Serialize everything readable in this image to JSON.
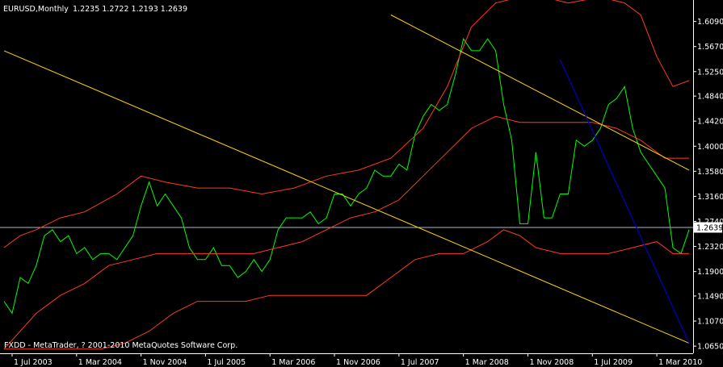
{
  "header": {
    "symbol_timeframe": "EURUSD,Monthly",
    "ohlc": "1.2235 1.2722 1.2193 1.2639"
  },
  "footer": {
    "copyright": "FXDD - MetaTrader, ? 2001-2010 MetaQuotes Software Corp."
  },
  "price_marker": {
    "label": "1.2639"
  },
  "colors": {
    "background": "#000000",
    "axis": "#ffffff",
    "price": "#00ff00",
    "bands": "#ff3b20",
    "channel": "#ffd700",
    "trendline_blue": "#0000c8",
    "price_line": "#b0b8c8"
  },
  "chart_data": {
    "type": "line",
    "title": "EURUSD,Monthly",
    "ylim": [
      1.053,
      1.645
    ],
    "y_ticks": [
      "1.6090",
      "1.5670",
      "1.5250",
      "1.4840",
      "1.4420",
      "1.4000",
      "1.3580",
      "1.3160",
      "1.2740",
      "1.2320",
      "1.1900",
      "1.1490",
      "1.1070",
      "1.0650"
    ],
    "x_ticks": [
      "1 Jul 2003",
      "1 Mar 2004",
      "1 Nov 2004",
      "1 Jul 2005",
      "1 Mar 2006",
      "1 Nov 2006",
      "1 Jul 2007",
      "1 Mar 2008",
      "1 Nov 2008",
      "1 Jul 2009",
      "1 Mar 2010"
    ],
    "x_start": "2003-06",
    "x_end": "2010-07",
    "series": [
      {
        "role": "price",
        "x": [
          "2003-06",
          "2003-07",
          "2003-08",
          "2003-09",
          "2003-10",
          "2003-11",
          "2003-12",
          "2004-01",
          "2004-02",
          "2004-03",
          "2004-04",
          "2004-05",
          "2004-06",
          "2004-07",
          "2004-08",
          "2004-09",
          "2004-10",
          "2004-11",
          "2004-12",
          "2005-01",
          "2005-02",
          "2005-03",
          "2005-04",
          "2005-05",
          "2005-06",
          "2005-07",
          "2005-08",
          "2005-09",
          "2005-10",
          "2005-11",
          "2005-12",
          "2006-01",
          "2006-02",
          "2006-03",
          "2006-04",
          "2006-05",
          "2006-06",
          "2006-07",
          "2006-08",
          "2006-09",
          "2006-10",
          "2006-11",
          "2006-12",
          "2007-01",
          "2007-02",
          "2007-03",
          "2007-04",
          "2007-05",
          "2007-06",
          "2007-07",
          "2007-08",
          "2007-09",
          "2007-10",
          "2007-11",
          "2007-12",
          "2008-01",
          "2008-02",
          "2008-03",
          "2008-04",
          "2008-05",
          "2008-06",
          "2008-07",
          "2008-08",
          "2008-09",
          "2008-10",
          "2008-11",
          "2008-12",
          "2009-01",
          "2009-02",
          "2009-03",
          "2009-04",
          "2009-05",
          "2009-06",
          "2009-07",
          "2009-08",
          "2009-09",
          "2009-10",
          "2009-11",
          "2009-12",
          "2010-01",
          "2010-02",
          "2010-03",
          "2010-04",
          "2010-05",
          "2010-06",
          "2010-07"
        ],
        "values": [
          1.14,
          1.12,
          1.18,
          1.17,
          1.2,
          1.25,
          1.26,
          1.24,
          1.25,
          1.22,
          1.23,
          1.21,
          1.22,
          1.22,
          1.21,
          1.23,
          1.25,
          1.3,
          1.34,
          1.3,
          1.32,
          1.3,
          1.28,
          1.23,
          1.21,
          1.21,
          1.23,
          1.2,
          1.2,
          1.18,
          1.19,
          1.21,
          1.19,
          1.21,
          1.26,
          1.28,
          1.28,
          1.28,
          1.29,
          1.27,
          1.28,
          1.32,
          1.32,
          1.3,
          1.32,
          1.33,
          1.36,
          1.35,
          1.35,
          1.37,
          1.36,
          1.42,
          1.45,
          1.47,
          1.46,
          1.47,
          1.52,
          1.58,
          1.56,
          1.56,
          1.58,
          1.56,
          1.47,
          1.41,
          1.27,
          1.27,
          1.39,
          1.28,
          1.28,
          1.32,
          1.32,
          1.41,
          1.4,
          1.41,
          1.43,
          1.47,
          1.48,
          1.5,
          1.43,
          1.39,
          1.37,
          1.35,
          1.33,
          1.23,
          1.22,
          1.26
        ]
      },
      {
        "role": "upper-band",
        "x": [
          "2003-06",
          "2003-08",
          "2003-10",
          "2004-01",
          "2004-04",
          "2004-08",
          "2004-11",
          "2005-02",
          "2005-06",
          "2005-10",
          "2006-02",
          "2006-06",
          "2006-10",
          "2007-02",
          "2007-06",
          "2007-10",
          "2008-01",
          "2008-04",
          "2008-07",
          "2008-10",
          "2009-01",
          "2009-04",
          "2009-08",
          "2009-11",
          "2010-01",
          "2010-03",
          "2010-05",
          "2010-07"
        ],
        "values": [
          1.23,
          1.25,
          1.26,
          1.28,
          1.29,
          1.32,
          1.35,
          1.34,
          1.33,
          1.33,
          1.32,
          1.33,
          1.35,
          1.36,
          1.38,
          1.43,
          1.5,
          1.6,
          1.64,
          1.65,
          1.65,
          1.64,
          1.65,
          1.64,
          1.62,
          1.55,
          1.5,
          1.51
        ]
      },
      {
        "role": "middle-band",
        "x": [
          "2003-06",
          "2003-08",
          "2003-10",
          "2004-01",
          "2004-04",
          "2004-07",
          "2004-10",
          "2005-01",
          "2005-04",
          "2005-07",
          "2005-10",
          "2006-01",
          "2006-04",
          "2006-07",
          "2006-10",
          "2007-01",
          "2007-04",
          "2007-07",
          "2007-10",
          "2008-01",
          "2008-04",
          "2008-07",
          "2008-10",
          "2009-01",
          "2009-04",
          "2009-07",
          "2009-10",
          "2010-01",
          "2010-04",
          "2010-07"
        ],
        "values": [
          1.06,
          1.09,
          1.12,
          1.15,
          1.17,
          1.2,
          1.21,
          1.22,
          1.22,
          1.22,
          1.22,
          1.22,
          1.23,
          1.24,
          1.26,
          1.28,
          1.29,
          1.31,
          1.35,
          1.39,
          1.43,
          1.45,
          1.44,
          1.44,
          1.44,
          1.44,
          1.43,
          1.41,
          1.38,
          1.38
        ]
      },
      {
        "role": "lower-band",
        "x": [
          "2003-06",
          "2003-09",
          "2003-12",
          "2004-03",
          "2004-06",
          "2004-09",
          "2004-12",
          "2005-03",
          "2005-06",
          "2005-09",
          "2005-12",
          "2006-03",
          "2006-06",
          "2006-09",
          "2006-12",
          "2007-03",
          "2007-06",
          "2007-09",
          "2007-12",
          "2008-03",
          "2008-06",
          "2008-08",
          "2008-10",
          "2008-12",
          "2009-03",
          "2009-06",
          "2009-09",
          "2009-12",
          "2010-03",
          "2010-05",
          "2010-07"
        ],
        "values": [
          1.06,
          1.06,
          1.06,
          1.06,
          1.06,
          1.07,
          1.09,
          1.12,
          1.14,
          1.14,
          1.14,
          1.15,
          1.15,
          1.15,
          1.15,
          1.15,
          1.18,
          1.21,
          1.22,
          1.22,
          1.24,
          1.26,
          1.25,
          1.23,
          1.22,
          1.22,
          1.22,
          1.23,
          1.24,
          1.22,
          1.22
        ]
      },
      {
        "role": "channel-lower",
        "x": [
          "2003-06",
          "2010-07"
        ],
        "values": [
          1.56,
          1.07
        ]
      },
      {
        "role": "channel-upper",
        "x": [
          "2007-06",
          "2010-07"
        ],
        "values": [
          1.62,
          1.36
        ]
      },
      {
        "role": "trendline-blue",
        "x": [
          "2009-03",
          "2010-07"
        ],
        "values": [
          1.545,
          1.07
        ]
      }
    ],
    "current_price": 1.2639
  }
}
